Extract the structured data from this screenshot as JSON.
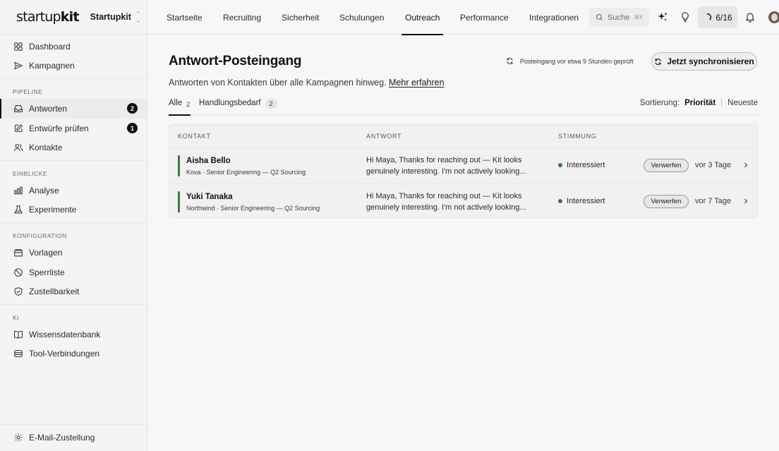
{
  "brand": {
    "logo_light": "startup",
    "logo_bold": "kit",
    "workspace": "Startupkit"
  },
  "sidebar": {
    "top_items": [
      {
        "label": "Dashboard",
        "icon": "grid-icon"
      },
      {
        "label": "Kampagnen",
        "icon": "send-icon"
      }
    ],
    "sections": [
      {
        "title": "PIPELINE",
        "items": [
          {
            "label": "Antworten",
            "icon": "inbox-icon",
            "badge": "2",
            "active": true
          },
          {
            "label": "Entwürfe prüfen",
            "icon": "pencil-icon",
            "badge": "1"
          },
          {
            "label": "Kontakte",
            "icon": "users-icon"
          }
        ]
      },
      {
        "title": "EINBLICKE",
        "items": [
          {
            "label": "Analyse",
            "icon": "bar-chart-icon"
          },
          {
            "label": "Experimente",
            "icon": "flask-icon"
          }
        ]
      },
      {
        "title": "KONFIGURATION",
        "items": [
          {
            "label": "Vorlagen",
            "icon": "folder-icon"
          },
          {
            "label": "Sperrliste",
            "icon": "ban-icon"
          },
          {
            "label": "Zustellbarkeit",
            "icon": "shield-check-icon"
          }
        ]
      },
      {
        "title": "KI",
        "items": [
          {
            "label": "Wissensdatenbank",
            "icon": "book-icon"
          },
          {
            "label": "Tool-Verbindungen",
            "icon": "database-icon"
          }
        ]
      }
    ],
    "footer_item": {
      "label": "E-Mail-Zustellung",
      "icon": "gear-icon"
    }
  },
  "topnav": {
    "tabs": [
      "Startseite",
      "Recruiting",
      "Sicherheit",
      "Schulungen",
      "Outreach",
      "Performance",
      "Integrationen"
    ],
    "active_tab": "Outreach",
    "search_placeholder": "Suche",
    "search_shortcut": "⌘K",
    "progress": "6/16"
  },
  "page": {
    "title": "Antwort-Posteingang",
    "subtitle": "Antworten von Kontakten über alle Kampagnen hinweg.",
    "learn_more": "Mehr erfahren",
    "sync_status": "Posteingang vor etwa 9 Stunden geprüft",
    "sync_button": "Jetzt synchronisieren",
    "filters": {
      "all_label": "Alle",
      "all_count": "2",
      "action_label": "Handlungsbedarf",
      "action_count": "2"
    },
    "sort": {
      "label": "Sortierung:",
      "selected": "Priorität",
      "other": "Neueste"
    }
  },
  "table": {
    "headers": [
      "KONTAKT",
      "ANTWORT",
      "STIMMUNG"
    ],
    "rows": [
      {
        "name": "Aisha Bello",
        "meta": "Kova · Senior Engineering — Q2 Sourcing",
        "reply_line1": "Hi Maya, Thanks for reaching out — Kit looks",
        "reply_line2": "genuinely interesting. I'm not actively looking...",
        "mood": "Interessiert",
        "discard": "Verwerfen",
        "time": "vor 3 Tage"
      },
      {
        "name": "Yuki Tanaka",
        "meta": "Northwind · Senior Engineering — Q2 Sourcing",
        "reply_line1": "Hi Maya, Thanks for reaching out — Kit looks",
        "reply_line2": "genuinely interesting. I'm not actively looking...",
        "mood": "Interessiert",
        "discard": "Verwerfen",
        "time": "vor 7 Tage"
      }
    ]
  },
  "colors": {
    "accent": "#111111",
    "positive": "#2f7a45",
    "row_bar": "#3b7a48"
  }
}
